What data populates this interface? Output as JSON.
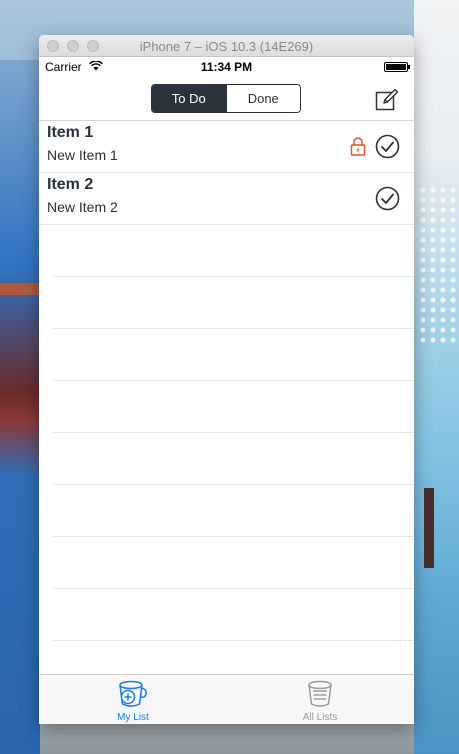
{
  "window": {
    "title": "iPhone 7 – iOS 10.3 (14E269)"
  },
  "status_bar": {
    "carrier": "Carrier",
    "time": "11:34 PM"
  },
  "nav": {
    "segments": [
      {
        "label": "To Do",
        "selected": true
      },
      {
        "label": "Done",
        "selected": false
      }
    ],
    "compose_icon": "compose-icon"
  },
  "list": {
    "items": [
      {
        "title": "Item 1",
        "subtitle": "New Item 1",
        "locked": true,
        "checked": true
      },
      {
        "title": "Item 2",
        "subtitle": "New Item 2",
        "locked": false,
        "checked": true
      }
    ]
  },
  "tab_bar": {
    "tabs": [
      {
        "label": "My List",
        "icon": "my-list-icon",
        "selected": true
      },
      {
        "label": "All Lists",
        "icon": "all-lists-icon",
        "selected": false
      }
    ]
  },
  "colors": {
    "accent": "#1a7ae0",
    "dark": "#2a323b",
    "lock": "#e0542a"
  }
}
